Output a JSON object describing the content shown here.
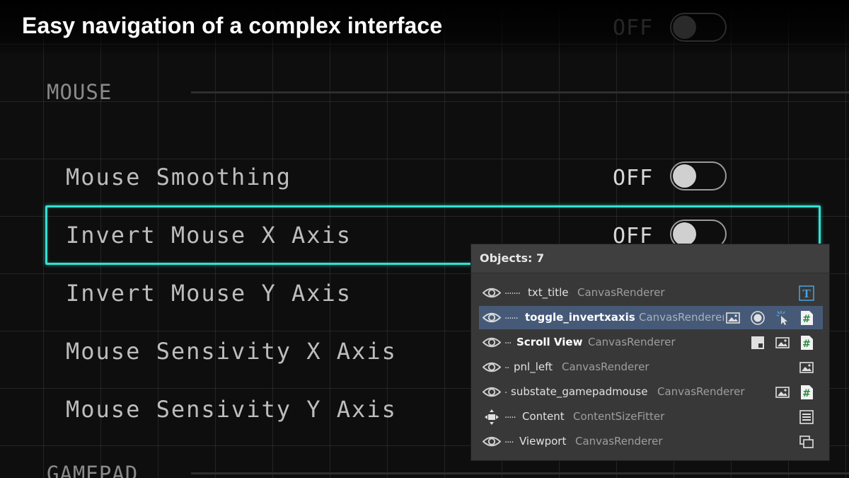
{
  "headline": "Easy navigation of a complex interface",
  "settings": {
    "top_toggle_state": "OFF",
    "sections": {
      "mouse": "MOUSE",
      "gamepad": "GAMEPAD"
    },
    "rows": [
      {
        "label": "Mouse Smoothing",
        "state": "OFF"
      },
      {
        "label": "Invert Mouse X Axis",
        "state": "OFF"
      },
      {
        "label": "Invert Mouse Y Axis"
      },
      {
        "label": "Mouse Sensivity X Axis"
      },
      {
        "label": "Mouse Sensivity Y Axis"
      }
    ],
    "highlight_color": "#35e0cf"
  },
  "panel": {
    "title": "Objects: 7",
    "objects": [
      {
        "dots": ".......",
        "name": "txt_title",
        "type": "CanvasRenderer",
        "icons": [
          "text-component-icon"
        ]
      },
      {
        "dots": "......",
        "name": "toggle_invertxaxis",
        "type": "CanvasRenderer",
        "icons": [
          "image-component-icon",
          "toggle-component-icon",
          "event-trigger-icon",
          "script-component-icon"
        ],
        "selected": true
      },
      {
        "dots": "...",
        "name": "Scroll View",
        "type": "CanvasRenderer",
        "icons": [
          "scrollrect-component-icon",
          "image-component-icon",
          "script-component-icon"
        ]
      },
      {
        "dots": "..",
        "name": "pnl_left",
        "type": "CanvasRenderer",
        "icons": [
          "image-component-icon"
        ]
      },
      {
        "dots": ".",
        "name": "substate_gamepadmouse",
        "type": "CanvasRenderer",
        "icons": [
          "image-component-icon",
          "script-component-icon"
        ]
      },
      {
        "dots": ".....",
        "name": "Content",
        "type": "ContentSizeFitter",
        "icons": [
          "layout-group-icon"
        ]
      },
      {
        "dots": "....",
        "name": "Viewport",
        "type": "CanvasRenderer",
        "icons": [
          "mask-component-icon"
        ]
      }
    ],
    "selected_color": "#465a78"
  }
}
